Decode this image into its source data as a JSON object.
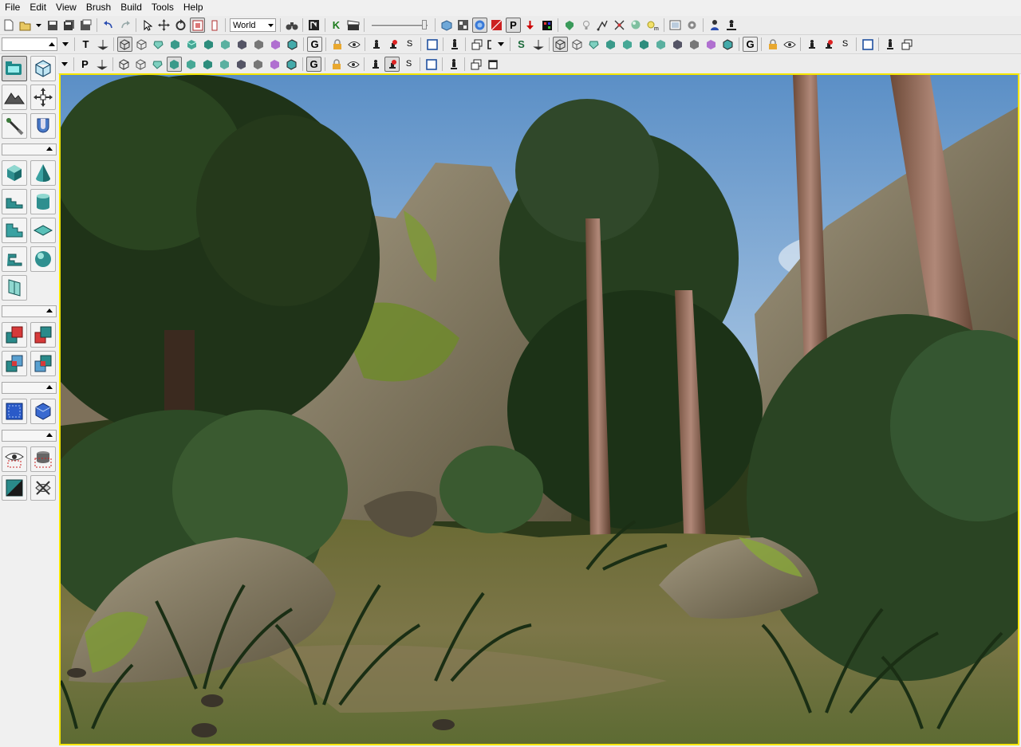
{
  "menu": [
    "File",
    "Edit",
    "View",
    "Brush",
    "Build",
    "Tools",
    "Help"
  ],
  "toolbar": {
    "coordinate_system": "World",
    "letters": {
      "kismet": "K",
      "paths": "P",
      "s": "S",
      "t": "T",
      "g": "G"
    },
    "slider_value": 0.95
  },
  "toolbox": {
    "tools": [
      "camera-mode",
      "geometry-mode",
      "terrain-mode",
      "texture-align",
      "mesh-paint",
      "material-mode",
      "cube-builder",
      "cone-builder",
      "curved-stair-builder",
      "cylinder-builder",
      "linear-stair-builder",
      "sheet-builder",
      "spiral-stair-builder",
      "sphere-builder",
      "volumetric-builder",
      "csg-add",
      "csg-subtract",
      "csg-intersect",
      "csg-deintersect",
      "add-volume",
      "add-special",
      "show-selected",
      "hide-selected",
      "select-invert",
      "show-all"
    ]
  },
  "viewport": {
    "border_color": "#f5e600",
    "scene": "forest-clearing"
  },
  "colors": {
    "sky": "#6e9ccc",
    "foliage": "#263d1e",
    "ground": "#6b6a3a",
    "rock": "#8a7e6a",
    "accent_selection": "#f5e600"
  }
}
